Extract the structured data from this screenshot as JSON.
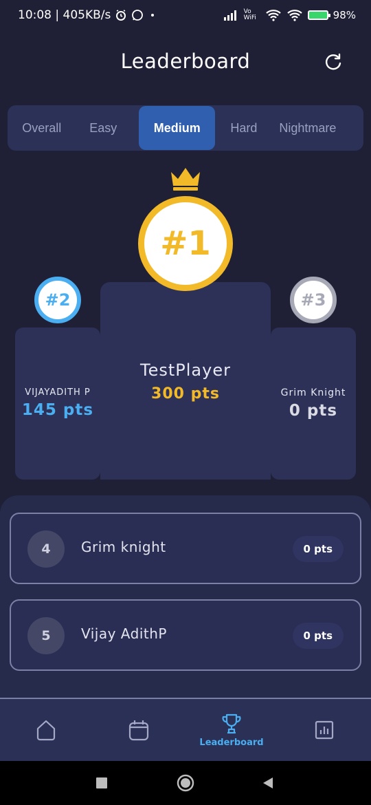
{
  "status_bar": {
    "time": "10:08 | 405KB/s",
    "battery_text": "98%",
    "vowifi_text": "Vo WiFi"
  },
  "header": {
    "title": "Leaderboard"
  },
  "tabs": [
    {
      "label": "Overall",
      "selected": false
    },
    {
      "label": "Easy",
      "selected": false
    },
    {
      "label": "Medium",
      "selected": true
    },
    {
      "label": "Hard",
      "selected": false
    },
    {
      "label": "Nightmare",
      "selected": false
    }
  ],
  "podium": {
    "first": {
      "rank": "#1",
      "name": "TestPlayer",
      "points": "300 pts"
    },
    "second": {
      "rank": "#2",
      "name": "VIJAYADITH P",
      "points": "145 pts"
    },
    "third": {
      "rank": "#3",
      "name": "Grim Knight",
      "points": "0 pts"
    }
  },
  "list": [
    {
      "rank": "4",
      "name": "Grim knight",
      "points": "0 pts"
    },
    {
      "rank": "5",
      "name": "Vijay AdithP",
      "points": "0 pts"
    }
  ],
  "bottom_nav": {
    "active_label": "Leaderboard",
    "items": [
      "home-icon",
      "calendar-icon",
      "trophy-icon",
      "stats-icon"
    ]
  },
  "colors": {
    "background": "#1f1f36",
    "gold": "#f2b928",
    "blue": "#4aaef0",
    "silver": "#a7a9b6",
    "tab_active": "#2f5fae"
  }
}
